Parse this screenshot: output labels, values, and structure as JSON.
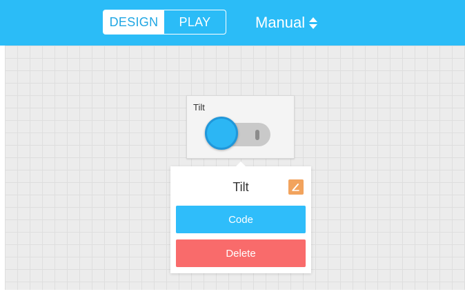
{
  "header": {
    "tabs": [
      {
        "label": "DESIGN",
        "active": true
      },
      {
        "label": "PLAY",
        "active": false
      }
    ],
    "mode_select": {
      "value": "Manual",
      "icon": "sort-arrows-icon"
    }
  },
  "widget": {
    "label": "Tilt",
    "control": "toggle-switch",
    "state": "off"
  },
  "popover": {
    "title": "Tilt",
    "edit_icon": "pencil-icon",
    "code_label": "Code",
    "delete_label": "Delete"
  },
  "colors": {
    "topbar": "#2bbcf7",
    "code_button": "#2fbdfa",
    "delete_button": "#f96b6b",
    "edit_button": "#f2a35d"
  }
}
